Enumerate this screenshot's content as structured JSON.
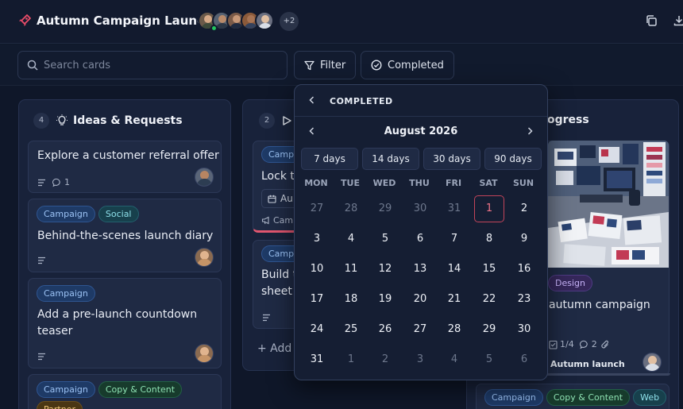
{
  "header": {
    "title": "Autumn Campaign Launch",
    "avatar_more": "+2",
    "colors": {
      "accent": "#ec4d6a",
      "online": "#22c55e"
    }
  },
  "toolbar": {
    "search_placeholder": "Search cards",
    "filter_label": "Filter",
    "completed_label": "Completed"
  },
  "columns": [
    {
      "count": "4",
      "title": "Ideas & Requests",
      "cards": [
        {
          "title": "Explore a customer referral offer",
          "comments": "1"
        },
        {
          "tags": [
            "Campaign",
            "Social"
          ],
          "title": "Behind-the-scenes launch diary"
        },
        {
          "tags": [
            "Campaign"
          ],
          "title_line1": "Add a pre-launch countdown",
          "title_line2": "teaser"
        },
        {
          "tags": [
            "Campaign",
            "Copy & Content",
            "Partner"
          ]
        }
      ]
    },
    {
      "count": "2",
      "cards": [
        {
          "tag": "Campa",
          "title": "Lock t",
          "date": "Au",
          "meta": "Cam"
        },
        {
          "tag": "Campa",
          "title_line1": "Build t",
          "title_line2": "sheet"
        }
      ],
      "add_label": "+ Add"
    },
    {
      "title_partial": "ogress",
      "cards": [
        {
          "tag": "Design",
          "title": "autumn campaign",
          "checklist": "1/4",
          "comments": "2",
          "milestone": "Autumn launch"
        },
        {
          "tags": [
            "Campaign",
            "Copy & Content",
            "Web"
          ]
        }
      ]
    }
  ],
  "calendar": {
    "title": "COMPLETED",
    "month": "August 2026",
    "presets": [
      "7 days",
      "14 days",
      "30 days",
      "90 days"
    ],
    "weekdays": [
      "MON",
      "TUE",
      "WED",
      "THU",
      "FRI",
      "SAT",
      "SUN"
    ],
    "weeks": [
      [
        {
          "d": "27",
          "o": true
        },
        {
          "d": "28",
          "o": true
        },
        {
          "d": "29",
          "o": true
        },
        {
          "d": "30",
          "o": true
        },
        {
          "d": "31",
          "o": true
        },
        {
          "d": "1",
          "sel": true
        },
        {
          "d": "2"
        }
      ],
      [
        {
          "d": "3"
        },
        {
          "d": "4"
        },
        {
          "d": "5"
        },
        {
          "d": "6"
        },
        {
          "d": "7"
        },
        {
          "d": "8"
        },
        {
          "d": "9"
        }
      ],
      [
        {
          "d": "10"
        },
        {
          "d": "11"
        },
        {
          "d": "12"
        },
        {
          "d": "13"
        },
        {
          "d": "14"
        },
        {
          "d": "15"
        },
        {
          "d": "16"
        }
      ],
      [
        {
          "d": "17"
        },
        {
          "d": "18"
        },
        {
          "d": "19"
        },
        {
          "d": "20"
        },
        {
          "d": "21"
        },
        {
          "d": "22"
        },
        {
          "d": "23"
        }
      ],
      [
        {
          "d": "24"
        },
        {
          "d": "25"
        },
        {
          "d": "26"
        },
        {
          "d": "27"
        },
        {
          "d": "28"
        },
        {
          "d": "29"
        },
        {
          "d": "30"
        }
      ],
      [
        {
          "d": "31"
        },
        {
          "d": "1",
          "o": true
        },
        {
          "d": "2",
          "o": true
        },
        {
          "d": "3",
          "o": true
        },
        {
          "d": "4",
          "o": true
        },
        {
          "d": "5",
          "o": true
        },
        {
          "d": "6",
          "o": true
        }
      ]
    ]
  }
}
